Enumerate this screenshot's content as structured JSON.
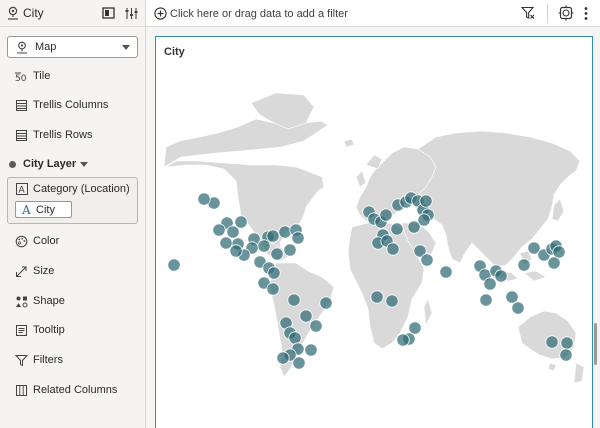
{
  "panel": {
    "title": "City",
    "viz_type": "Map",
    "items_top": [
      {
        "id": "tile",
        "label": "Tile",
        "icon": "tile-icon"
      },
      {
        "id": "trellis-columns",
        "label": "Trellis Columns",
        "icon": "trellis-columns-icon"
      },
      {
        "id": "trellis-rows",
        "label": "Trellis Rows",
        "icon": "trellis-rows-icon"
      }
    ],
    "layer": {
      "label": "City Layer"
    },
    "category": {
      "label": "Category (Location)",
      "value_chip": "City"
    },
    "items_bottom": [
      {
        "id": "color",
        "label": "Color",
        "icon": "palette-icon"
      },
      {
        "id": "size",
        "label": "Size",
        "icon": "size-icon"
      },
      {
        "id": "shape",
        "label": "Shape",
        "icon": "shape-icon"
      },
      {
        "id": "tooltip",
        "label": "Tooltip",
        "icon": "tooltip-icon"
      },
      {
        "id": "filters",
        "label": "Filters",
        "icon": "filter-icon"
      },
      {
        "id": "related-columns",
        "label": "Related Columns",
        "icon": "related-columns-icon"
      }
    ]
  },
  "toolbar": {
    "filter_hint": "Click here or drag data to add a filter"
  },
  "viz": {
    "title": "City",
    "marker_color": "#2f6b74",
    "land_color": "#d9d9d9",
    "border_color": "#2f8fb0"
  }
}
